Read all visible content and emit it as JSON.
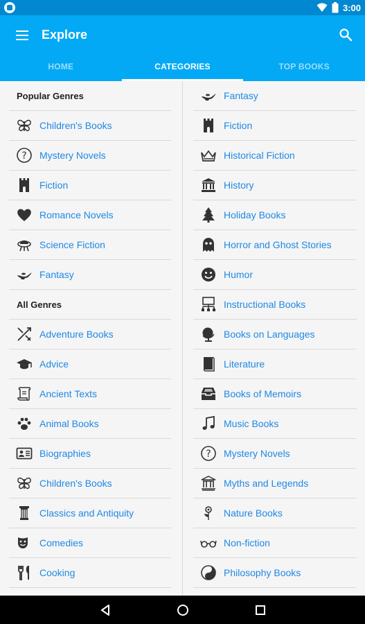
{
  "status_bar": {
    "time": "3:00"
  },
  "app_bar": {
    "title": "Explore"
  },
  "tabs": [
    {
      "label": "HOME",
      "active": false
    },
    {
      "label": "CATEGORIES",
      "active": true
    },
    {
      "label": "TOP BOOKS",
      "active": false
    }
  ],
  "left_column": {
    "popular_header": "Popular Genres",
    "popular": [
      {
        "label": "Children's Books",
        "icon": "butterfly-icon"
      },
      {
        "label": "Mystery Novels",
        "icon": "question-icon"
      },
      {
        "label": "Fiction",
        "icon": "tower-icon"
      },
      {
        "label": "Romance Novels",
        "icon": "heart-icon"
      },
      {
        "label": "Science Fiction",
        "icon": "alien-icon"
      },
      {
        "label": "Fantasy",
        "icon": "lamp-icon"
      }
    ],
    "all_header": "All Genres",
    "all": [
      {
        "label": "Adventure Books",
        "icon": "swords-icon"
      },
      {
        "label": "Advice",
        "icon": "graduation-cap-icon"
      },
      {
        "label": "Ancient Texts",
        "icon": "scroll-icon"
      },
      {
        "label": "Animal Books",
        "icon": "paw-icon"
      },
      {
        "label": "Biographies",
        "icon": "id-card-icon"
      },
      {
        "label": "Children's Books",
        "icon": "butterfly-icon"
      },
      {
        "label": "Classics and Antiquity",
        "icon": "column-icon"
      },
      {
        "label": "Comedies",
        "icon": "theater-masks-icon"
      },
      {
        "label": "Cooking",
        "icon": "fork-knife-icon"
      }
    ]
  },
  "right_column": [
    {
      "label": "Fantasy",
      "icon": "lamp-icon"
    },
    {
      "label": "Fiction",
      "icon": "tower-icon"
    },
    {
      "label": "Historical Fiction",
      "icon": "crown-icon"
    },
    {
      "label": "History",
      "icon": "museum-icon"
    },
    {
      "label": "Holiday Books",
      "icon": "tree-icon"
    },
    {
      "label": "Horror and Ghost Stories",
      "icon": "ghost-icon"
    },
    {
      "label": "Humor",
      "icon": "smiley-icon"
    },
    {
      "label": "Instructional Books",
      "icon": "presentation-icon"
    },
    {
      "label": "Books on Languages",
      "icon": "globe-icon"
    },
    {
      "label": "Literature",
      "icon": "book-icon"
    },
    {
      "label": "Books of Memoirs",
      "icon": "inbox-icon"
    },
    {
      "label": "Music Books",
      "icon": "music-note-icon"
    },
    {
      "label": "Mystery Novels",
      "icon": "question-icon"
    },
    {
      "label": "Myths and Legends",
      "icon": "temple-icon"
    },
    {
      "label": "Nature Books",
      "icon": "flower-icon"
    },
    {
      "label": "Non-fiction",
      "icon": "glasses-icon"
    },
    {
      "label": "Philosophy Books",
      "icon": "yin-yang-icon"
    }
  ],
  "colors": {
    "status_bar": "#0288d1",
    "app_bar": "#03a9f4",
    "link": "#1e88e5"
  }
}
